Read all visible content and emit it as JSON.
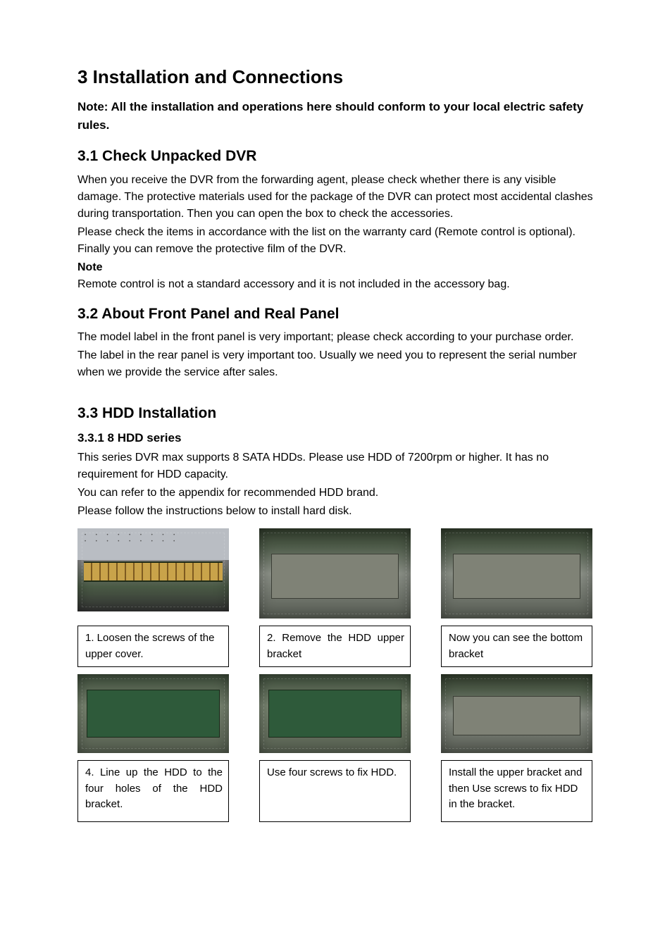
{
  "h1": "3  Installation and Connections",
  "top_note": "Note: All the installation and operations here should conform to your local electric safety rules.",
  "s31": {
    "heading": "3.1  Check Unpacked DVR",
    "p1": "When you receive the DVR from the forwarding agent, please check whether there is any visible damage. The protective materials used for the package of the DVR can protect most accidental clashes during transportation. Then you can open the box to check the accessories.",
    "p2": "Please check the items in accordance with the list on the warranty card (Remote control is optional). Finally you can remove the protective film of the DVR.",
    "note_label": "Note",
    "note_body": "Remote control is not a standard accessory and it is not included in the accessory bag."
  },
  "s32": {
    "heading": "3.2  About Front Panel and Real Panel",
    "p1": "The model label in the front panel is very important; please check according to your purchase order.",
    "p2": "The label in the rear panel is very important too. Usually we need you to represent the serial number when we provide the service after sales."
  },
  "s33": {
    "heading": "3.3  HDD Installation",
    "sub": "3.3.1  8 HDD series",
    "p1": "This series DVR max supports 8 SATA HDDs. Please use HDD of 7200rpm or higher. It has no requirement for HDD capacity.",
    "p2": "You can refer to the appendix for recommended HDD brand.",
    "p3": "Please follow the instructions below to install hard disk."
  },
  "captions": {
    "c1": " 1. Loosen the screws of the upper cover.",
    "c2": " 2. Remove the HDD upper bracket",
    "c3": "   Now you can see the bottom bracket",
    "c4": " 4. Line up the HDD to the four holes of the HDD bracket.",
    "c5": "Use four screws to fix HDD.",
    "c6": "   Install the upper bracket and then Use screws to fix HDD in the bracket."
  }
}
